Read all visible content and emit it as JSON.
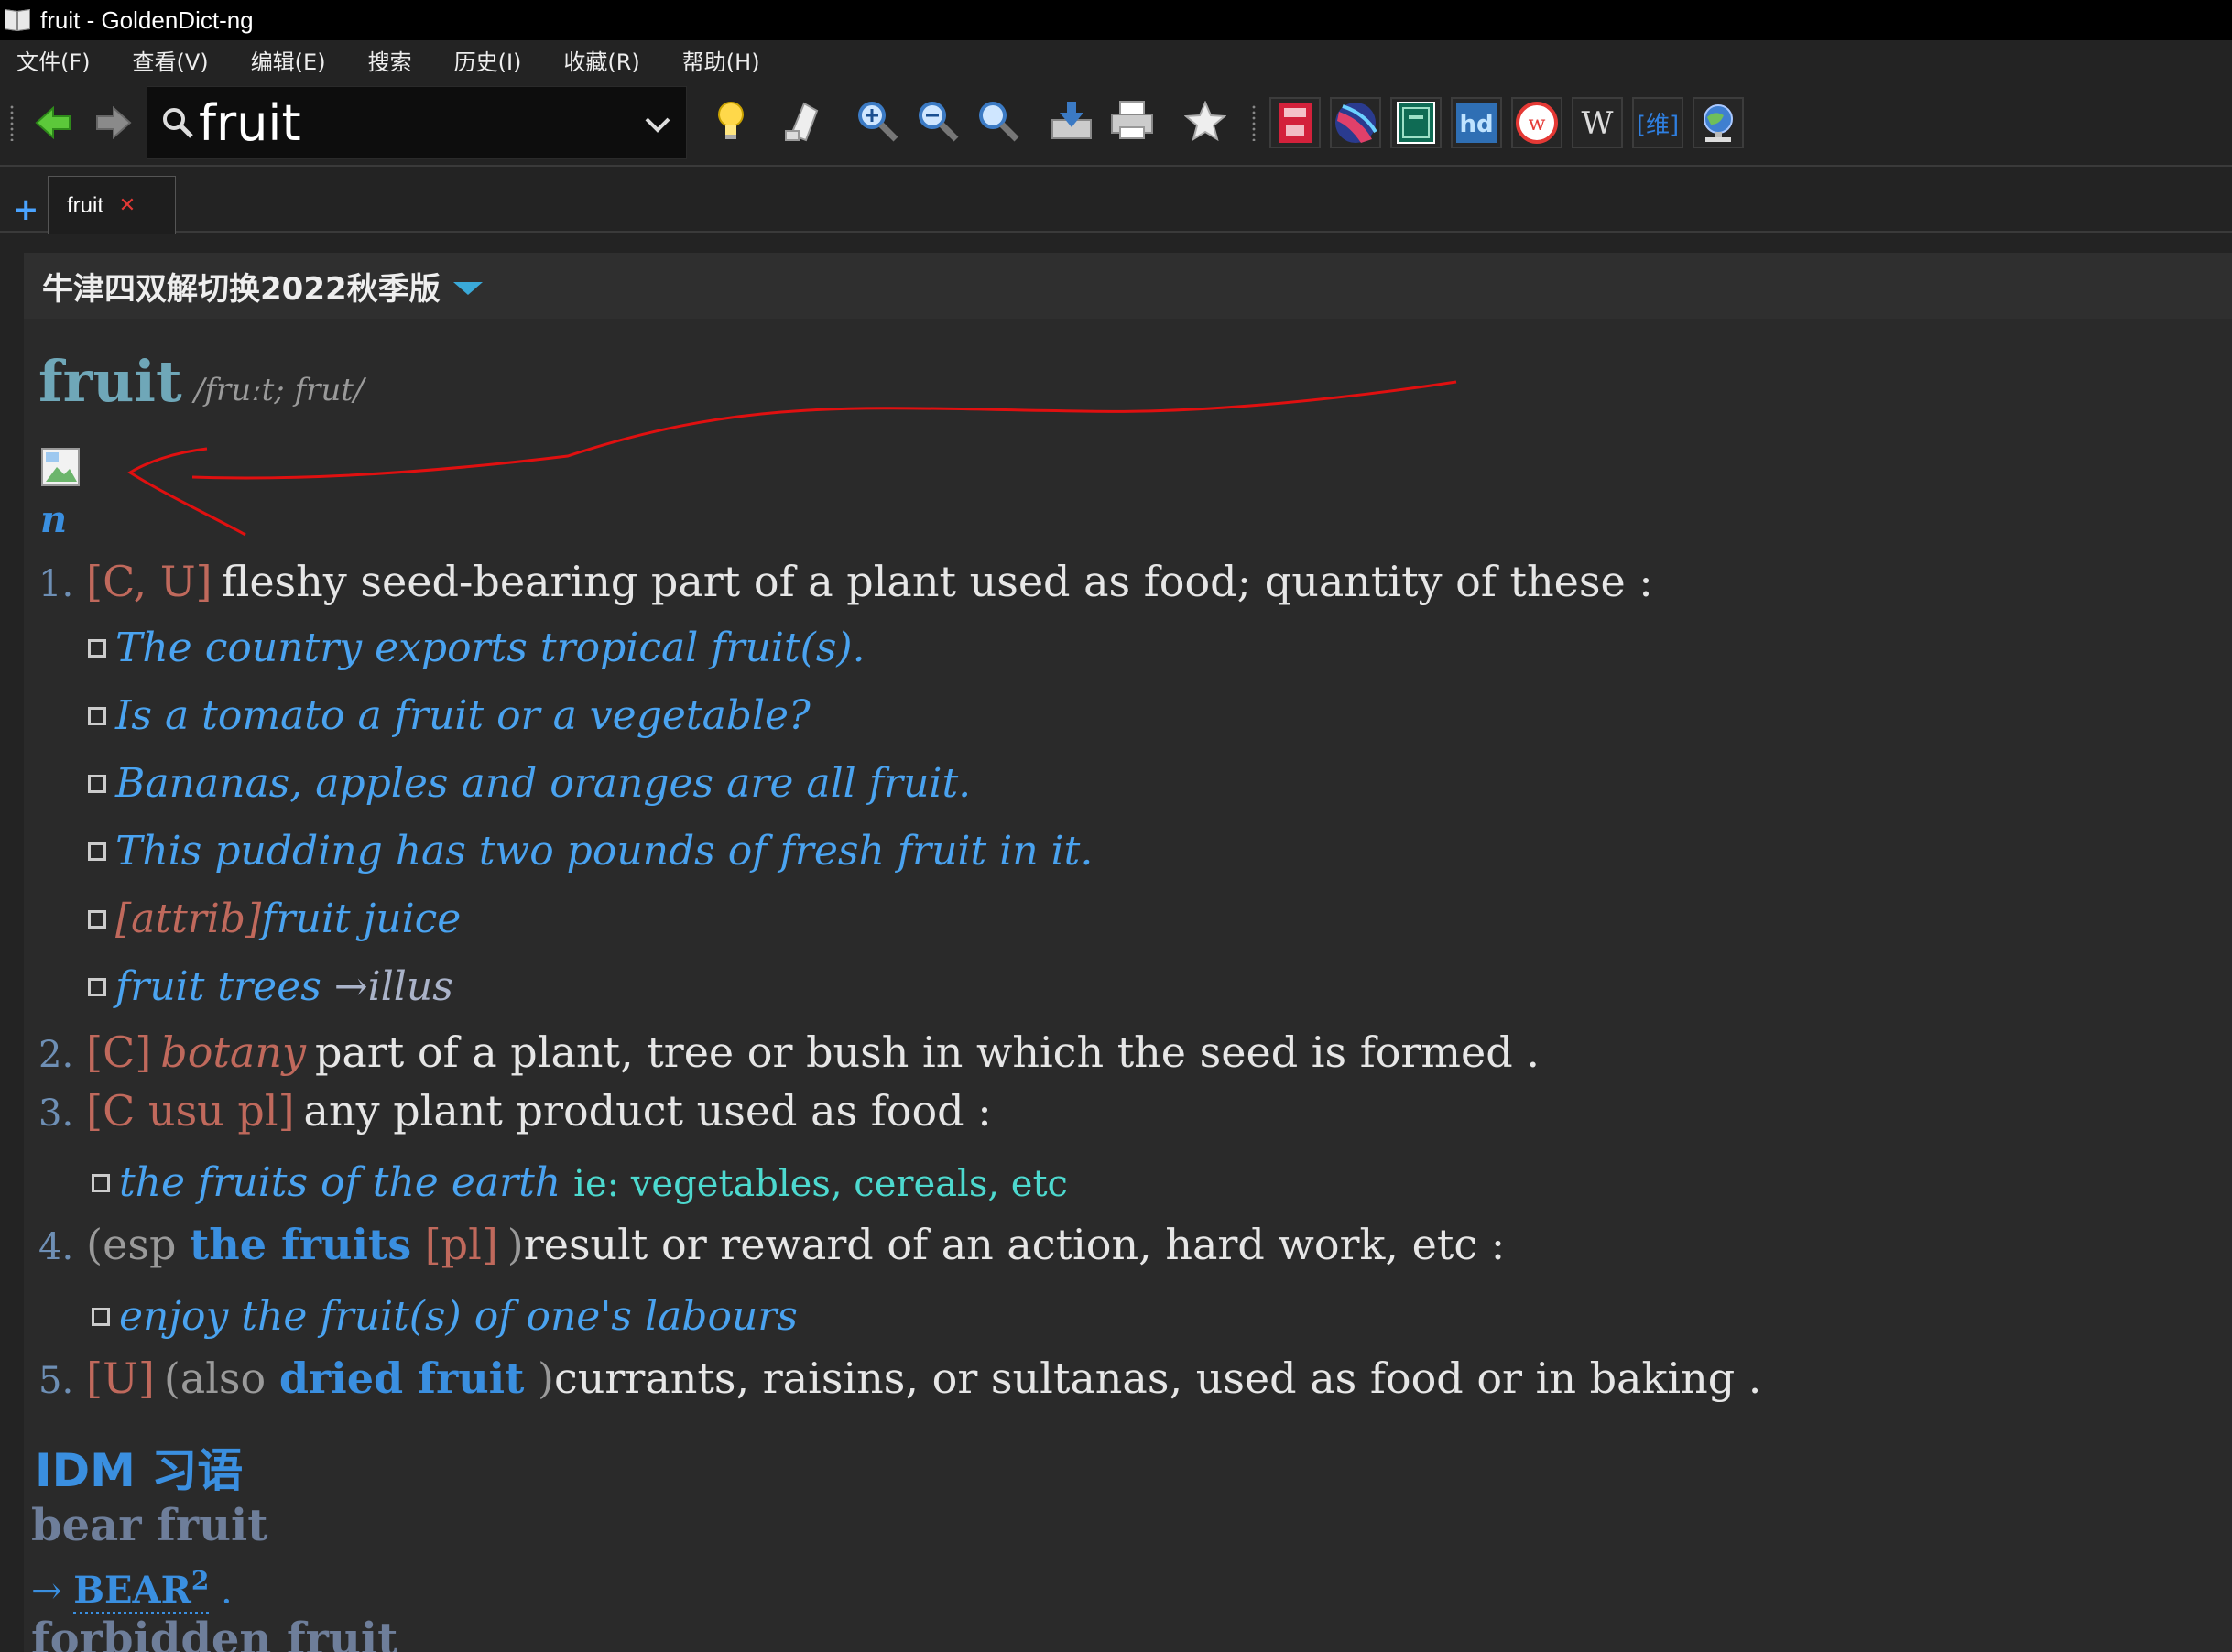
{
  "window": {
    "title": "fruit - GoldenDict-ng"
  },
  "menu": {
    "items": [
      "文件(F)",
      "查看(V)",
      "编辑(E)",
      "搜索",
      "历史(I)",
      "收藏(R)",
      "帮助(H)"
    ]
  },
  "toolbar": {
    "search_value": "fruit",
    "icons": [
      "back-arrow-icon",
      "forward-arrow-icon",
      "lightbulb-icon",
      "scan-popup-icon",
      "zoom-in-icon",
      "zoom-out-icon",
      "zoom-reset-icon",
      "save-icon",
      "print-icon",
      "favorite-star-icon"
    ],
    "dictionary_icons": [
      "oxford-dict-icon",
      "globe-dict-icon",
      "green-book-dict-icon",
      "hd-dict-icon",
      "wordreference-icon",
      "wikipedia-icon",
      "wei-dict-icon",
      "network-dict-icon"
    ],
    "wikipedia_label": "W",
    "hd_label": "hd",
    "wei_label": "[维]"
  },
  "tabs": [
    {
      "label": "fruit"
    }
  ],
  "article": {
    "dictionary_name": "牛津四双解切换2022秋季版",
    "headword": "fruit",
    "phonetic": "/fruːt; frut/",
    "part_of_speech": "n",
    "senses": [
      {
        "num": "1.",
        "grammar": "[C, U]",
        "definition": "fleshy seed-bearing part of a plant used as food; quantity of these :",
        "examples": [
          {
            "text": "The country exports tropical fruit(s)."
          },
          {
            "text": "Is a tomato a fruit or a vegetable?"
          },
          {
            "text": "Bananas, apples and oranges are all fruit."
          },
          {
            "text": "This pudding has two pounds of fresh fruit in it."
          },
          {
            "attrib": "[attrib]",
            "text": "fruit juice"
          },
          {
            "text": "fruit trees",
            "illus": "→illus"
          }
        ]
      },
      {
        "num": "2.",
        "grammar": "[C]",
        "label": "botany",
        "definition": "part of a plant, tree or bush in which the seed is formed ."
      },
      {
        "num": "3.",
        "grammar": "[C usu pl]",
        "definition": "any plant product used as food :",
        "examples": [
          {
            "text": "the fruits of the earth",
            "gloss": "ie: vegetables, cereals, etc"
          }
        ]
      },
      {
        "num": "4.",
        "paren_open": "(esp",
        "xref": "the fruits",
        "grammar": "[pl]",
        "paren_close": ")",
        "definition": "result or reward of an action, hard work, etc :",
        "examples": [
          {
            "text": "enjoy the fruit(s) of one's labours"
          }
        ]
      },
      {
        "num": "5.",
        "grammar": "[U]",
        "paren_open": "(also",
        "xref": "dried fruit",
        "paren_close": ")",
        "definition": "currants, raisins, or sultanas, used as food or in baking ."
      }
    ],
    "idioms_heading": "IDM 习语",
    "idioms": [
      {
        "phrase": "bear fruit",
        "ref_arrow": "→",
        "ref": "BEAR",
        "ref_sup": "2",
        "ref_tail": "."
      },
      {
        "phrase": "forbidden fruit"
      }
    ]
  },
  "colors": {
    "background": "#2a2a2a",
    "headword": "#6fa7b8",
    "example": "#4aa3f0",
    "grammar": "#c0695c",
    "annotation": "#e01010"
  }
}
